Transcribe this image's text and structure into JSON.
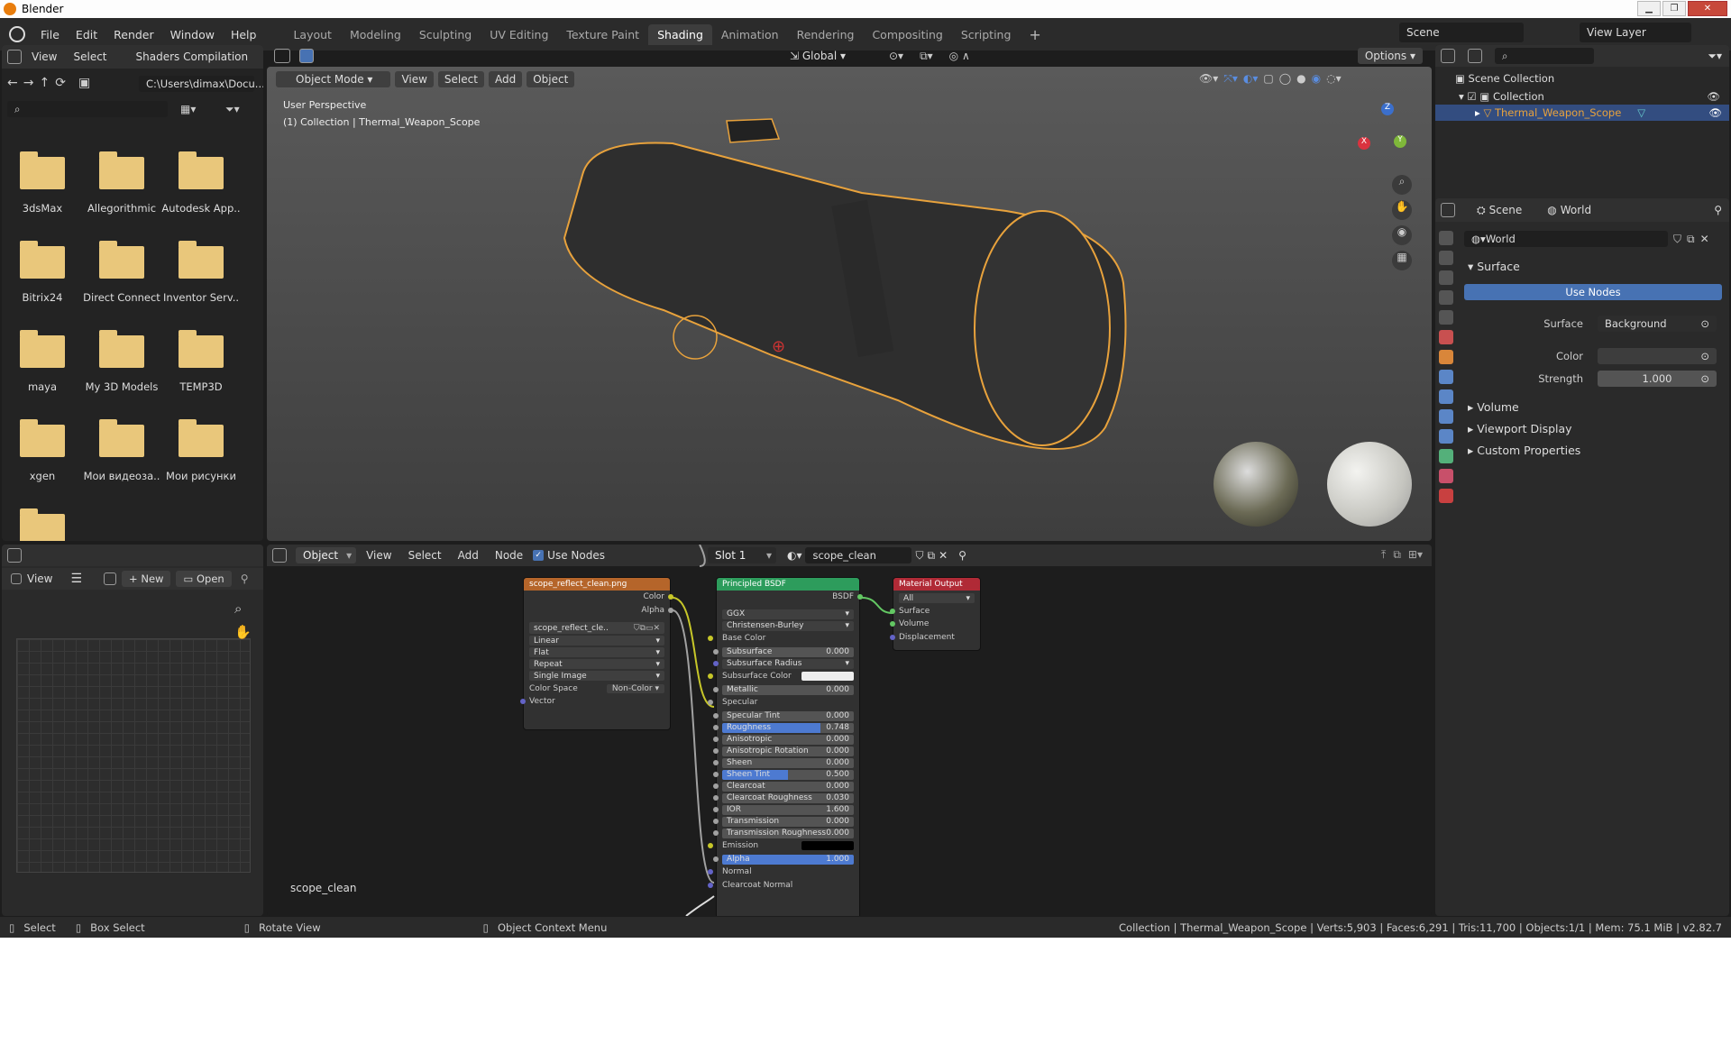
{
  "window": {
    "title": "Blender"
  },
  "menu": [
    "File",
    "Edit",
    "Render",
    "Window",
    "Help"
  ],
  "workspaces": [
    "Layout",
    "Modeling",
    "Sculpting",
    "UV Editing",
    "Texture Paint",
    "Shading",
    "Animation",
    "Rendering",
    "Compositing",
    "Scripting"
  ],
  "active_workspace": "Shading",
  "scene": {
    "name": "Scene",
    "view_layer": "View Layer"
  },
  "file_browser": {
    "header": [
      "View",
      "Select",
      "Shaders Compilation"
    ],
    "path": "C:\\Users\\dimax\\Docu...",
    "folders": [
      "3dsMax",
      "Allegorithmic",
      "Autodesk App..",
      "Bitrix24",
      "Direct Connect",
      "Inventor Serv..",
      "maya",
      "My 3D Models",
      "TEMP3D",
      "xgen",
      "Мои видеоза..",
      "Мои рисунки"
    ]
  },
  "image_editor": {
    "view": "View",
    "new": "New",
    "open": "Open"
  },
  "viewport": {
    "mode": "Object Mode",
    "menus": [
      "View",
      "Select",
      "Add",
      "Object"
    ],
    "transform": "Global",
    "options": "Options",
    "overlay_line1": "User Perspective",
    "overlay_line2": "(1) Collection | Thermal_Weapon_Scope",
    "gizmo": {
      "x": "X",
      "y": "Y",
      "z": "Z"
    }
  },
  "node_editor": {
    "type": "Object",
    "menus": [
      "View",
      "Select",
      "Add",
      "Node"
    ],
    "use_nodes": "Use Nodes",
    "slot": "Slot 1",
    "material": "scope_clean",
    "footer_label": "scope_clean",
    "image_node": {
      "title": "scope_reflect_clean.png",
      "outputs": [
        "Color",
        "Alpha"
      ],
      "image": "scope_reflect_cle..",
      "interp": "Linear",
      "proj": "Flat",
      "ext": "Repeat",
      "src": "Single Image",
      "colorspace_label": "Color Space",
      "colorspace": "Non-Color",
      "vector": "Vector"
    },
    "bsdf_node": {
      "title": "Principled BSDF",
      "output": "BSDF",
      "distribution": "GGX",
      "subsurface_method": "Christensen-Burley",
      "rows": [
        {
          "label": "Base Color",
          "type": "plain"
        },
        {
          "label": "Subsurface",
          "value": "0.000"
        },
        {
          "label": "Subsurface Radius",
          "type": "dd"
        },
        {
          "label": "Subsurface Color",
          "type": "color"
        },
        {
          "label": "Metallic",
          "value": "0.000"
        },
        {
          "label": "Specular",
          "type": "plain"
        },
        {
          "label": "Specular Tint",
          "value": "0.000"
        },
        {
          "label": "Roughness",
          "value": "0.748",
          "fill": 0.748
        },
        {
          "label": "Anisotropic",
          "value": "0.000"
        },
        {
          "label": "Anisotropic Rotation",
          "value": "0.000"
        },
        {
          "label": "Sheen",
          "value": "0.000"
        },
        {
          "label": "Sheen Tint",
          "value": "0.500",
          "fill": 0.5
        },
        {
          "label": "Clearcoat",
          "value": "0.000"
        },
        {
          "label": "Clearcoat Roughness",
          "value": "0.030"
        },
        {
          "label": "IOR",
          "value": "1.600"
        },
        {
          "label": "Transmission",
          "value": "0.000"
        },
        {
          "label": "Transmission Roughness",
          "value": "0.000"
        },
        {
          "label": "Emission",
          "type": "black"
        },
        {
          "label": "Alpha",
          "value": "1.000",
          "fill": 1.0
        },
        {
          "label": "Normal",
          "type": "plain"
        },
        {
          "label": "Clearcoat Normal",
          "type": "plain"
        }
      ]
    },
    "output_node": {
      "title": "Material Output",
      "target": "All",
      "inputs": [
        "Surface",
        "Volume",
        "Displacement"
      ]
    }
  },
  "outliner": {
    "scene_collection": "Scene Collection",
    "collection": "Collection",
    "object": "Thermal_Weapon_Scope"
  },
  "properties": {
    "scene_tab": "Scene",
    "world_tab": "World",
    "world_name": "World",
    "surface_section": "Surface",
    "use_nodes": "Use Nodes",
    "surface_label": "Surface",
    "surface_value": "Background",
    "color_label": "Color",
    "strength_label": "Strength",
    "strength_value": "1.000",
    "sections": [
      "Volume",
      "Viewport Display",
      "Custom Properties"
    ]
  },
  "statusbar": {
    "left": [
      "Select",
      "Box Select",
      "Rotate View",
      "Object Context Menu"
    ],
    "right": "Collection | Thermal_Weapon_Scope | Verts:5,903 | Faces:6,291 | Tris:11,700 | Objects:1/1 | Mem: 75.1 MiB | v2.82.7"
  },
  "colors": {
    "accent": "#4772b3",
    "selection": "#e8a23c",
    "image_node": "#b5652a",
    "bsdf_node": "#2d9c5c",
    "output_node": "#b02a36"
  }
}
